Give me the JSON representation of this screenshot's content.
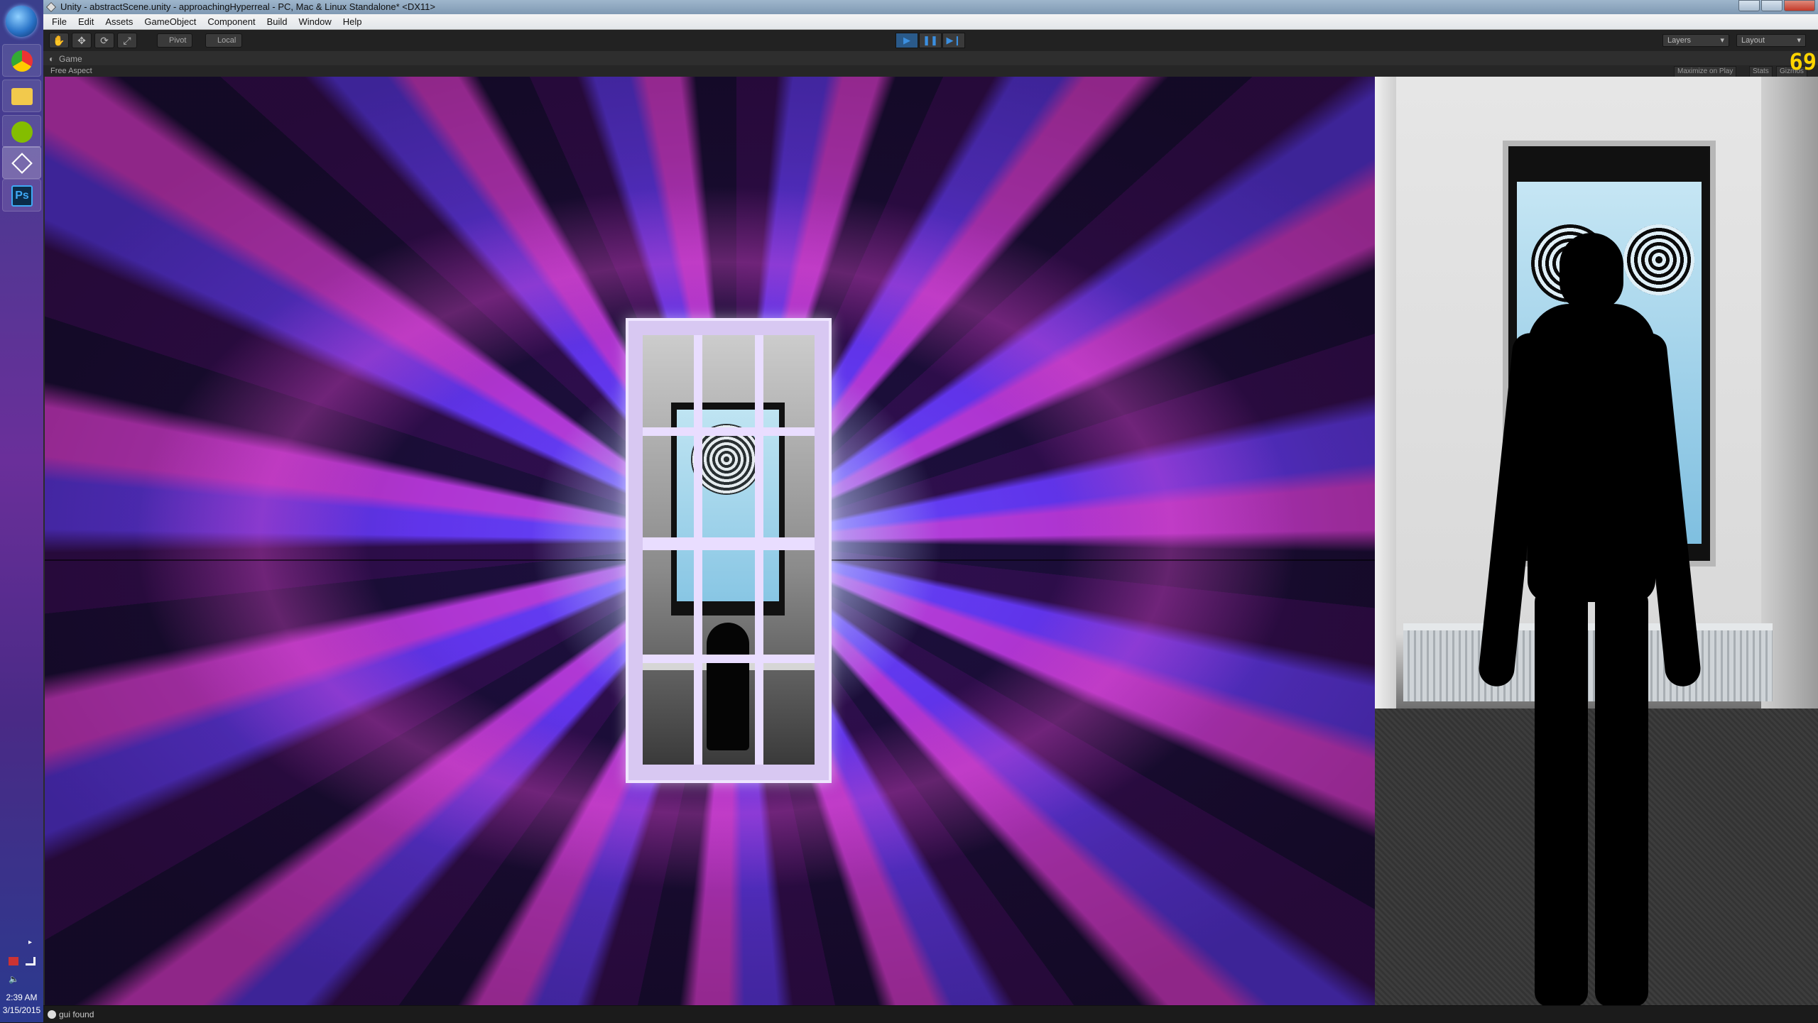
{
  "taskbar": {
    "apps": [
      {
        "name": "chrome",
        "icon": "chrome-icon"
      },
      {
        "name": "file-explorer",
        "icon": "folder-icon"
      },
      {
        "name": "spotify",
        "icon": "spotify-icon"
      },
      {
        "name": "unity",
        "icon": "unity-icon"
      },
      {
        "name": "photoshop",
        "icon": "photoshop-icon",
        "label": "Ps"
      }
    ],
    "clock": {
      "time": "2:39 AM",
      "date": "3/15/2015"
    }
  },
  "window": {
    "title": "Unity - abstractScene.unity - approachingHyperreal - PC, Mac & Linux Standalone* <DX11>"
  },
  "menu": [
    "File",
    "Edit",
    "Assets",
    "GameObject",
    "Component",
    "Build",
    "Window",
    "Help"
  ],
  "toolbar": {
    "pivot_label": "Pivot",
    "local_label": "Local",
    "layers_label": "Layers",
    "layout_label": "Layout"
  },
  "game": {
    "tab_label": "Game",
    "aspect_label": "Free Aspect",
    "maximize_label": "Maximize on Play",
    "stats_label": "Stats",
    "gizmos_label": "Gizmos",
    "fps": "69"
  },
  "status": {
    "message": "gui found"
  },
  "colors": {
    "accent_play": "#3b8fe0",
    "fps": "#ffd400",
    "vortex_purple": "#5b2ad0",
    "vortex_pink": "#e63cd2"
  }
}
